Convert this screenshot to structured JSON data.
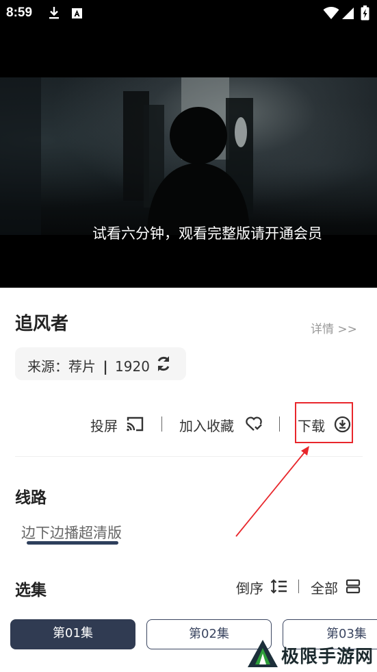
{
  "status_bar": {
    "time": "8:59"
  },
  "video": {
    "subtitle": "试看六分钟，观看完整版请开通会员"
  },
  "info": {
    "title": "追风者",
    "detail_link": "详情 >>",
    "source": {
      "label": "来源：荐片",
      "separator": "|",
      "year": "1920"
    }
  },
  "actions": {
    "cast_label": "投屏",
    "favorite_label": "加入收藏",
    "download_label": "下载"
  },
  "route_section": {
    "title": "线路",
    "selected_route": "边下边播超清版"
  },
  "episodes_section": {
    "title": "选集",
    "sort_label": "倒序",
    "all_label": "全部",
    "episodes": [
      "第01集",
      "第02集",
      "第03集"
    ]
  },
  "watermark": {
    "text": "极限手游网"
  },
  "colors": {
    "accent_dark": "#303b52",
    "highlight_red": "#e8262b"
  }
}
